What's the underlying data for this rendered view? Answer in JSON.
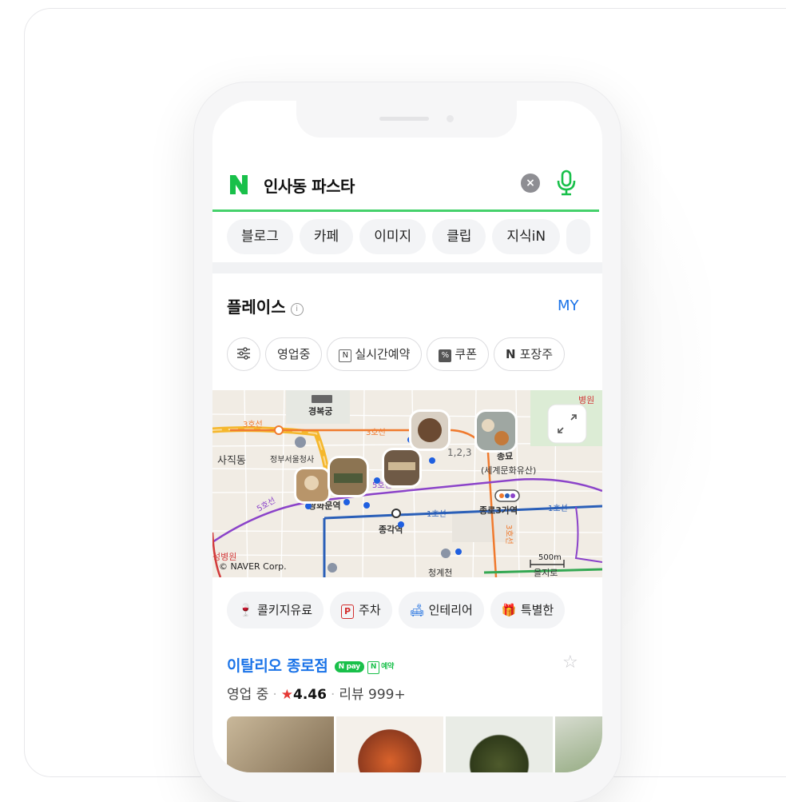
{
  "search": {
    "query": "인사동 파스타",
    "clear_icon": "close-circle-icon",
    "mic_icon": "microphone-icon",
    "accent_color": "#45d16b"
  },
  "tabs": [
    {
      "label": "블로그"
    },
    {
      "label": "카페"
    },
    {
      "label": "이미지"
    },
    {
      "label": "클립"
    },
    {
      "label": "지식iN"
    }
  ],
  "place_section": {
    "title": "플레이스",
    "my_label": "MY"
  },
  "filters": [
    {
      "label": "영업중"
    },
    {
      "label": "실시간예약",
      "badge": "N"
    },
    {
      "label": "쿠폰",
      "badge": "%"
    },
    {
      "label": "포장주",
      "badge": "N"
    }
  ],
  "map": {
    "labels": {
      "gyeongbokgung": "경복궁",
      "sajikdong": "사직동",
      "govcomplex": "정부서울청사",
      "gwanghwamun": "광화문역",
      "jonggak": "종각역",
      "jongmyo": "종묘",
      "jongmyo_sub": "(세계문화유산)",
      "jongno3": "종로3가역",
      "cheonggyecheon": "청계천",
      "euljiro": "을지로",
      "line1_a": "1호선",
      "line1_b": "1호선",
      "line3_a": "3호선",
      "line3_b": "3호선",
      "line3_c": "3호선",
      "line5_a": "5호선",
      "line5_b": "5호선",
      "hospital_right": "병원",
      "hospital_left": "성병원",
      "copyright": "© NAVER Corp.",
      "scale": "500m",
      "line_123": "1,2,3"
    }
  },
  "amenities": [
    {
      "label": "콜키지유료",
      "icon": "wine-glass-icon"
    },
    {
      "label": "주차",
      "icon": "parking-icon"
    },
    {
      "label": "인테리어",
      "icon": "sofa-icon"
    },
    {
      "label": "특별한",
      "icon": "gift-icon"
    }
  ],
  "restaurant": {
    "name": "이탈리오 종로점",
    "npay": "N pay",
    "reserve_badge": "N",
    "reserve_text": "예약",
    "status": "영업 중",
    "rating": "4.46",
    "reviews": "리뷰 999+"
  }
}
